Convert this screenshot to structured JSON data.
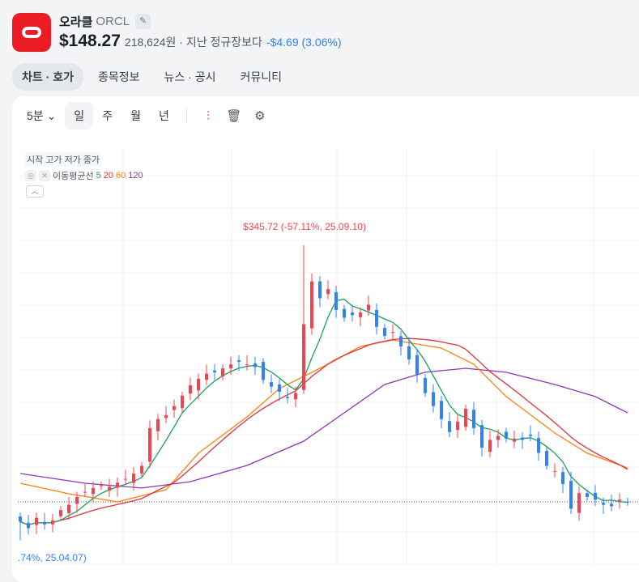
{
  "stock": {
    "name": "오라클",
    "ticker": "ORCL",
    "price": "$148.27",
    "krw": "218,624원 · 지난 정규장보다",
    "change": "-$4.69 (3.06%)"
  },
  "tabs": [
    "차트 · 호가",
    "종목정보",
    "뉴스 · 공시",
    "커뮤니티"
  ],
  "toolbar": {
    "interval": "5분",
    "periods": [
      "일",
      "주",
      "월",
      "년"
    ]
  },
  "legend": {
    "ohlc": "시작 고가 저가 종가",
    "ma_label": "이동평균선",
    "ma": [
      "5",
      "20",
      "60",
      "120"
    ]
  },
  "colors": {
    "up": "#f04452",
    "down": "#3182f6",
    "ma5": "#17a05d",
    "ma20": "#e0313f",
    "ma60": "#ff7f0e",
    "ma120": "#8e35b8"
  },
  "chart_data": {
    "type": "candlestick",
    "current_price": 148.27,
    "high_label": "$345.72 (-57.11%, 25.09.10)",
    "high": 345.72,
    "low_label": ".74%, 25.04.07)",
    "low": 118.86,
    "closes": [
      133,
      128,
      136,
      131,
      134,
      142,
      146,
      152,
      156,
      159,
      161,
      160,
      163,
      166,
      170,
      176,
      205,
      212,
      215,
      222,
      230,
      238,
      243,
      247,
      248,
      251,
      254,
      256,
      254,
      252,
      242,
      237,
      233,
      228,
      232,
      285,
      318,
      305,
      312,
      296,
      290,
      292,
      294,
      300,
      283,
      276,
      279,
      268,
      258,
      246,
      232,
      222,
      212,
      202,
      210,
      220,
      205,
      190,
      196,
      199,
      197,
      197,
      196,
      199,
      186,
      176,
      172,
      162,
      143,
      155,
      152,
      150,
      146,
      145,
      150,
      148.27
    ],
    "ma60": [
      [
        0,
        162.6
      ],
      [
        6,
        154.5
      ],
      [
        12,
        148.3
      ],
      [
        18,
        157.6
      ],
      [
        22,
        185.7
      ],
      [
        28,
        213.7
      ],
      [
        32,
        235.5
      ],
      [
        38,
        254.2
      ],
      [
        42,
        267.9
      ],
      [
        46,
        272.9
      ],
      [
        52,
        266.6
      ],
      [
        56,
        254.2
      ],
      [
        60,
        229.3
      ],
      [
        66,
        201.2
      ],
      [
        70,
        185.7
      ],
      [
        75,
        174.4
      ]
    ],
    "ma120": [
      [
        0,
        170.1
      ],
      [
        8,
        162.6
      ],
      [
        15,
        158.9
      ],
      [
        21,
        163.8
      ],
      [
        28,
        176.3
      ],
      [
        35,
        195
      ],
      [
        40,
        216.8
      ],
      [
        45,
        238.6
      ],
      [
        50,
        248
      ],
      [
        55,
        251.1
      ],
      [
        60,
        248
      ],
      [
        66,
        238.6
      ],
      [
        71,
        229.3
      ],
      [
        75,
        216.8
      ]
    ]
  }
}
